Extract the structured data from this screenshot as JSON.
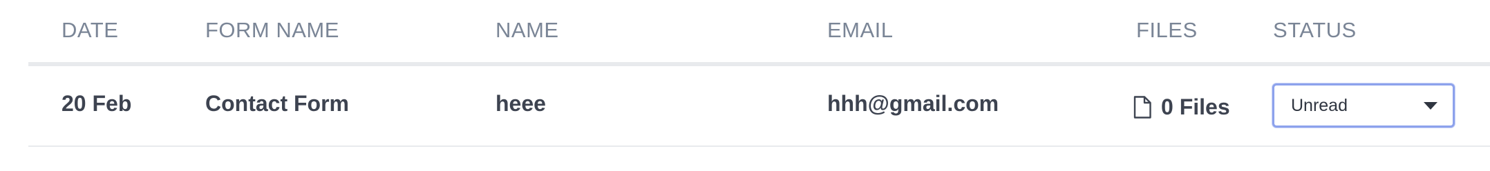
{
  "table": {
    "headers": {
      "date": "DATE",
      "form_name": "FORM NAME",
      "name": "NAME",
      "email": "EMAIL",
      "files": "FILES",
      "status": "STATUS"
    },
    "rows": [
      {
        "date": "20 Feb",
        "form_name": "Contact Form",
        "name": "heee",
        "email": "hhh@gmail.com",
        "files": "0 Files",
        "files_icon": "file-icon",
        "status": "Unread"
      }
    ]
  },
  "colors": {
    "header_text": "#7a8596",
    "cell_text": "#3d4350",
    "select_focus_border": "#8da2ec",
    "divider": "#e8eaed"
  }
}
